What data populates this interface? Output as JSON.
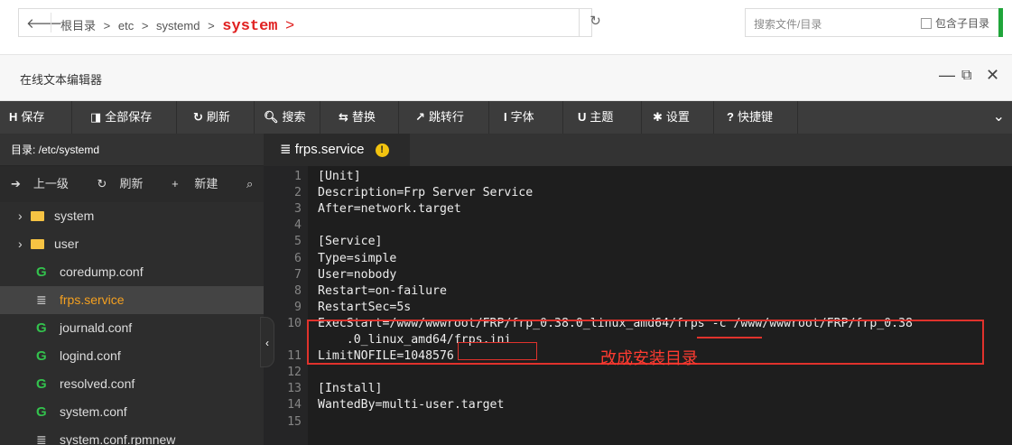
{
  "address_bar": {
    "back_icon": "back-arrow-icon",
    "breadcrumbs": [
      "根目录",
      "etc",
      "systemd"
    ],
    "breadcrumb_separator": ">",
    "current_dir": "system",
    "current_arrow": ">",
    "refresh_icon": "refresh-icon",
    "search_placeholder": "搜索文件/目录",
    "include_subdir_label": "包含子目录"
  },
  "window": {
    "title": "在线文本编辑器",
    "minimize": "—",
    "maximize": "⧉",
    "close": "✕"
  },
  "toolbar": {
    "items": [
      {
        "icon": "H",
        "label": "保存"
      },
      {
        "icon": "◨",
        "label": "全部保存"
      },
      {
        "icon": "↻",
        "label": "刷新"
      },
      {
        "icon": "🔍︎",
        "label": "搜索"
      },
      {
        "icon": "⇆",
        "label": "替换"
      },
      {
        "icon": "↗",
        "label": "跳转行"
      },
      {
        "icon": "I",
        "label": "字体"
      },
      {
        "icon": "U",
        "label": "主题"
      },
      {
        "icon": "✱",
        "label": "设置"
      },
      {
        "icon": "?",
        "label": "快捷键"
      }
    ],
    "collapse": "⌄"
  },
  "sidebar": {
    "dir_label": "目录: /etc/systemd",
    "actions": [
      {
        "icon": "➔",
        "label": "上一级"
      },
      {
        "icon": "↻",
        "label": "刷新"
      },
      {
        "icon": "+",
        "label": "新建"
      },
      {
        "icon": "⌕",
        "label": "搜索"
      }
    ],
    "items": [
      {
        "type": "folder",
        "label": "system"
      },
      {
        "type": "folder",
        "label": "user"
      },
      {
        "type": "file",
        "icon": "G",
        "label": "coredump.conf"
      },
      {
        "type": "file-doc",
        "icon": "≣",
        "label": "frps.service",
        "active": true
      },
      {
        "type": "file",
        "icon": "G",
        "label": "journald.conf"
      },
      {
        "type": "file",
        "icon": "G",
        "label": "logind.conf"
      },
      {
        "type": "file",
        "icon": "G",
        "label": "resolved.conf"
      },
      {
        "type": "file",
        "icon": "G",
        "label": "system.conf"
      },
      {
        "type": "file-doc",
        "icon": "≣",
        "label": "system.conf.rpmnew"
      }
    ],
    "collapse_handle": "‹"
  },
  "tab": {
    "icon": "≣",
    "label": "frps.service",
    "warning": "!"
  },
  "code_lines": [
    {
      "n": "1",
      "t": "[Unit]"
    },
    {
      "n": "2",
      "t": "Description=Frp Server Service"
    },
    {
      "n": "3",
      "t": "After=network.target"
    },
    {
      "n": "4",
      "t": ""
    },
    {
      "n": "5",
      "t": "[Service]"
    },
    {
      "n": "6",
      "t": "Type=simple"
    },
    {
      "n": "7",
      "t": "User=nobody"
    },
    {
      "n": "8",
      "t": "Restart=on-failure"
    },
    {
      "n": "9",
      "t": "RestartSec=5s"
    },
    {
      "n": "10",
      "t": "ExecStart=/www/wwwroot/FRP/frp_0.38.0_linux_amd64/frps -c /www/wwwroot/FRP/frp_0.38"
    },
    {
      "n": "",
      "t": "    .0_linux_amd64/frps.ini"
    },
    {
      "n": "11",
      "t": "LimitNOFILE=1048576"
    },
    {
      "n": "12",
      "t": ""
    },
    {
      "n": "13",
      "t": "[Install]"
    },
    {
      "n": "14",
      "t": "WantedBy=multi-user.target"
    },
    {
      "n": "15",
      "t": ""
    }
  ],
  "annotation": {
    "text": "改成安装目录",
    "color": "#ff3b30"
  },
  "colors": {
    "accent_green": "#20a53a",
    "active_file": "#f4a020",
    "editor_bg": "#1e1e1e",
    "highlight_red": "#e0322c"
  }
}
